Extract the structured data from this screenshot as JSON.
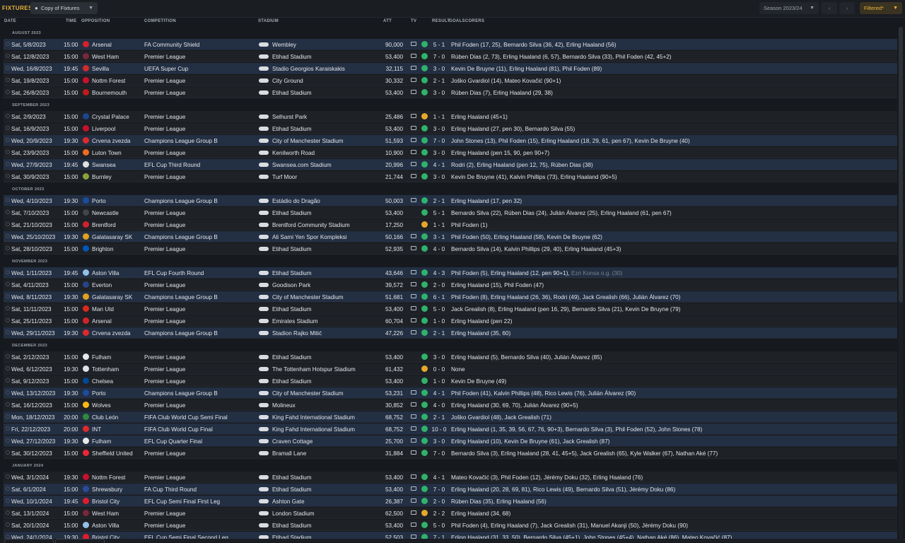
{
  "header": {
    "title": "FIXTURES",
    "view_label": "Copy of Fixtures",
    "season_label": "Season 2023/24",
    "prev_icon": "chevron-left-icon",
    "next_icon": "chevron-right-icon",
    "filter_label": "Filtered*"
  },
  "columns": {
    "date": "DATE",
    "time": "TIME",
    "opposition": "OPPOSITION",
    "competition": "COMPETITION",
    "stadium": "STADIUM",
    "att": "ATT",
    "tv": "TV",
    "result": "RESULT",
    "goalscorers": "GOALSCORERS"
  },
  "colors": {
    "win": "#2fb36b",
    "draw": "#e7a82a",
    "accent": "#e9b53a",
    "alt_row": "#232f43"
  },
  "months": [
    {
      "label": "AUGUST 2023",
      "fixtures": [
        {
          "date": "Sat, 5/8/2023",
          "time": "15:00",
          "opp": "Arsenal",
          "crest": "#d3222b",
          "comp": "FA Community Shield",
          "stadium": "Wembley",
          "att": "90,000",
          "tv": true,
          "outcome": "W",
          "score": "5 - 1",
          "scorers": "Phil Foden (17, 25), Bernardo Silva (36, 42), Erling Haaland (56)",
          "alt": true
        },
        {
          "date": "Sat, 12/8/2023",
          "time": "15:00",
          "opp": "West Ham",
          "crest": "#7a263a",
          "comp": "Premier League",
          "stadium": "Etihad Stadium",
          "att": "53,400",
          "tv": true,
          "outcome": "W",
          "score": "7 - 0",
          "scorers": "Rúben Dias (2, 73), Erling Haaland (6, 57), Bernardo Silva (33), Phil Foden (42, 45+2)"
        },
        {
          "date": "Wed, 16/8/2023",
          "time": "19:45",
          "opp": "Sevilla",
          "crest": "#d42a2a",
          "comp": "UEFA Super Cup",
          "stadium": "Stadio Georgios Karaiskakis",
          "att": "32,115",
          "tv": true,
          "outcome": "W",
          "score": "3 - 0",
          "scorers": "Kevin De Bruyne (11), Erling Haaland (81), Phil Foden (89)",
          "alt": true
        },
        {
          "date": "Sat, 19/8/2023",
          "time": "15:00",
          "opp": "Nottm Forest",
          "crest": "#c8102e",
          "comp": "Premier League",
          "stadium": "City Ground",
          "att": "30,332",
          "tv": true,
          "outcome": "W",
          "score": "2 - 1",
          "scorers": "Joško Gvardiol (14), Mateo Kovačić (90+1)"
        },
        {
          "date": "Sat, 26/8/2023",
          "time": "15:00",
          "opp": "Bournemouth",
          "crest": "#c01a1a",
          "comp": "Premier League",
          "stadium": "Etihad Stadium",
          "att": "53,400",
          "tv": true,
          "outcome": "W",
          "score": "3 - 0",
          "scorers": "Rúben Dias (7), Erling Haaland (29, 38)"
        }
      ]
    },
    {
      "label": "SEPTEMBER 2023",
      "fixtures": [
        {
          "date": "Sat, 2/9/2023",
          "time": "15:00",
          "opp": "Crystal Palace",
          "crest": "#1b458f",
          "comp": "Premier League",
          "stadium": "Selhurst Park",
          "att": "25,486",
          "tv": true,
          "outcome": "D",
          "score": "1 - 1",
          "scorers": "Erling Haaland (45+1)"
        },
        {
          "date": "Sat, 16/9/2023",
          "time": "15:00",
          "opp": "Liverpool",
          "crest": "#c8102e",
          "comp": "Premier League",
          "stadium": "Etihad Stadium",
          "att": "53,400",
          "tv": true,
          "outcome": "W",
          "score": "3 - 0",
          "scorers": "Erling Haaland (27, pen 30), Bernardo Silva (55)"
        },
        {
          "date": "Wed, 20/9/2023",
          "time": "19:30",
          "opp": "Crvena zvezda",
          "crest": "#e02a2a",
          "comp": "Champions League Group B",
          "stadium": "City of Manchester Stadium",
          "att": "51,593",
          "tv": true,
          "outcome": "W",
          "score": "7 - 0",
          "scorers": "John Stones (13), Phil Foden (15), Erling Haaland (18, 29, 61, pen 67), Kevin De Bruyne (40)",
          "alt": true
        },
        {
          "date": "Sat, 23/9/2023",
          "time": "15:00",
          "opp": "Luton Town",
          "crest": "#f26b21",
          "comp": "Premier League",
          "stadium": "Kenilworth Road",
          "att": "10,900",
          "tv": true,
          "outcome": "W",
          "score": "3 - 0",
          "scorers": "Erling Haaland (pen 15, 90, pen 90+7)"
        },
        {
          "date": "Wed, 27/9/2023",
          "time": "19:45",
          "opp": "Swansea",
          "crest": "#e0e0e0",
          "comp": "EFL Cup Third Round",
          "stadium": "Swansea.com Stadium",
          "att": "20,996",
          "tv": true,
          "outcome": "W",
          "score": "4 - 1",
          "scorers": "Rodri (2), Erling Haaland (pen 12, 75), Rúben Dias (38)",
          "alt": true
        },
        {
          "date": "Sat, 30/9/2023",
          "time": "15:00",
          "opp": "Burnley",
          "crest": "#8aa23a",
          "comp": "Premier League",
          "stadium": "Turf Moor",
          "att": "21,744",
          "tv": true,
          "outcome": "W",
          "score": "3 - 0",
          "scorers": "Kevin De Bruyne (41), Kalvin Phillips (73), Erling Haaland (90+5)"
        }
      ]
    },
    {
      "label": "OCTOBER 2023",
      "fixtures": [
        {
          "date": "Wed, 4/10/2023",
          "time": "19:30",
          "opp": "Porto",
          "crest": "#1c4c9c",
          "comp": "Champions League Group B",
          "stadium": "Estádio do Dragão",
          "att": "50,003",
          "tv": true,
          "outcome": "W",
          "score": "2 - 1",
          "scorers": "Erling Haaland (17, pen 32)",
          "alt": true
        },
        {
          "date": "Sat, 7/10/2023",
          "time": "15:00",
          "opp": "Newcastle",
          "crest": "#444444",
          "comp": "Premier League",
          "stadium": "Etihad Stadium",
          "att": "53,400",
          "tv": false,
          "outcome": "W",
          "score": "5 - 1",
          "scorers": "Bernardo Silva (22), Rúben Dias (24), Julián Álvarez (25), Erling Haaland (61, pen 67)"
        },
        {
          "date": "Sat, 21/10/2023",
          "time": "15:00",
          "opp": "Brentford",
          "crest": "#d2202f",
          "comp": "Premier League",
          "stadium": "Brentford Community Stadium",
          "att": "17,250",
          "tv": false,
          "outcome": "D",
          "score": "1 - 1",
          "scorers": "Phil Foden (1)"
        },
        {
          "date": "Wed, 25/10/2023",
          "time": "19:30",
          "opp": "Galatasaray SK",
          "crest": "#e0a020",
          "comp": "Champions League Group B",
          "stadium": "Ali Sami Yen Spor Kompleksi",
          "att": "50,166",
          "tv": true,
          "outcome": "W",
          "score": "3 - 1",
          "scorers": "Phil Foden (50), Erling Haaland (58), Kevin De Bruyne (62)",
          "alt": true
        },
        {
          "date": "Sat, 28/10/2023",
          "time": "15:00",
          "opp": "Brighton",
          "crest": "#0057b8",
          "comp": "Premier League",
          "stadium": "Etihad Stadium",
          "att": "52,935",
          "tv": true,
          "outcome": "W",
          "score": "4 - 0",
          "scorers": "Bernardo Silva (14), Kalvin Phillips (29, 40), Erling Haaland (45+3)"
        }
      ]
    },
    {
      "label": "NOVEMBER 2023",
      "fixtures": [
        {
          "date": "Wed, 1/11/2023",
          "time": "19:45",
          "opp": "Aston Villa",
          "crest": "#95bfe5",
          "comp": "EFL Cup Fourth Round",
          "stadium": "Etihad Stadium",
          "att": "43,646",
          "tv": true,
          "outcome": "W",
          "score": "4 - 3",
          "scorers": "Phil Foden (5), Erling Haaland (12, pen 90+1), ",
          "og": "Ezri Konsa o.g. (30)",
          "alt": true
        },
        {
          "date": "Sat, 4/11/2023",
          "time": "15:00",
          "opp": "Everton",
          "crest": "#274488",
          "comp": "Premier League",
          "stadium": "Goodison Park",
          "att": "39,572",
          "tv": true,
          "outcome": "W",
          "score": "2 - 0",
          "scorers": "Erling Haaland (15), Phil Foden (47)"
        },
        {
          "date": "Wed, 8/11/2023",
          "time": "19:30",
          "opp": "Galatasaray SK",
          "crest": "#e0a020",
          "comp": "Champions League Group B",
          "stadium": "City of Manchester Stadium",
          "att": "51,681",
          "tv": true,
          "outcome": "W",
          "score": "6 - 1",
          "scorers": "Phil Foden (8), Erling Haaland (26, 36), Rodri (49), Jack Grealish (66), Julián Álvarez (70)",
          "alt": true
        },
        {
          "date": "Sat, 11/11/2023",
          "time": "15:00",
          "opp": "Man Utd",
          "crest": "#da291c",
          "comp": "Premier League",
          "stadium": "Etihad Stadium",
          "att": "53,400",
          "tv": true,
          "outcome": "W",
          "score": "5 - 0",
          "scorers": "Jack Grealish (8), Erling Haaland (pen 16, 29), Bernardo Silva (21), Kevin De Bruyne (79)"
        },
        {
          "date": "Sat, 25/11/2023",
          "time": "15:00",
          "opp": "Arsenal",
          "crest": "#d3222b",
          "comp": "Premier League",
          "stadium": "Emirates Stadium",
          "att": "60,704",
          "tv": true,
          "outcome": "W",
          "score": "1 - 0",
          "scorers": "Erling Haaland (pen 22)"
        },
        {
          "date": "Wed, 29/11/2023",
          "time": "19:30",
          "opp": "Crvena zvezda",
          "crest": "#e02a2a",
          "comp": "Champions League Group B",
          "stadium": "Stadion Rajko Mitić",
          "att": "47,226",
          "tv": true,
          "outcome": "W",
          "score": "2 - 1",
          "scorers": "Erling Haaland (35, 60)",
          "alt": true
        }
      ]
    },
    {
      "label": "DECEMBER 2023",
      "fixtures": [
        {
          "date": "Sat, 2/12/2023",
          "time": "15:00",
          "opp": "Fulham",
          "crest": "#e8e8e8",
          "comp": "Premier League",
          "stadium": "Etihad Stadium",
          "att": "53,400",
          "tv": false,
          "outcome": "W",
          "score": "3 - 0",
          "scorers": "Erling Haaland (5), Bernardo Silva (40), Julián Álvarez (85)"
        },
        {
          "date": "Wed, 6/12/2023",
          "time": "19:30",
          "opp": "Tottenham",
          "crest": "#dfe2e8",
          "comp": "Premier League",
          "stadium": "The Tottenham Hotspur Stadium",
          "att": "61,432",
          "tv": false,
          "outcome": "D",
          "score": "0 - 0",
          "scorers": "None"
        },
        {
          "date": "Sat, 9/12/2023",
          "time": "15:00",
          "opp": "Chelsea",
          "crest": "#034694",
          "comp": "Premier League",
          "stadium": "Etihad Stadium",
          "att": "53,400",
          "tv": false,
          "outcome": "W",
          "score": "1 - 0",
          "scorers": "Kevin De Bruyne (49)"
        },
        {
          "date": "Wed, 13/12/2023",
          "time": "19:30",
          "opp": "Porto",
          "crest": "#1c4c9c",
          "comp": "Champions League Group B",
          "stadium": "City of Manchester Stadium",
          "att": "53,231",
          "tv": true,
          "outcome": "W",
          "score": "4 - 1",
          "scorers": "Phil Foden (41), Kalvin Phillips (48), Rico Lewis (76), Julián Álvarez (90)",
          "alt": true
        },
        {
          "date": "Sat, 16/12/2023",
          "time": "15:00",
          "opp": "Wolves",
          "crest": "#fdb913",
          "comp": "Premier League",
          "stadium": "Molineux",
          "att": "30,852",
          "tv": true,
          "outcome": "W",
          "score": "4 - 0",
          "scorers": "Erling Haaland (30, 69, 70), Julián Álvarez (90+5)"
        },
        {
          "date": "Mon, 18/12/2023",
          "time": "20:00",
          "opp": "Club León",
          "crest": "#2e8b3e",
          "comp": "FIFA Club World Cup Semi Final",
          "stadium": "King Fahd International Stadium",
          "att": "68,752",
          "tv": true,
          "outcome": "W",
          "score": "2 - 1",
          "scorers": "Joško Gvardiol (48), Jack Grealish (71)",
          "alt": true
        },
        {
          "date": "Fri, 22/12/2023",
          "time": "20:00",
          "opp": "INT",
          "crest": "#e02a2a",
          "comp": "FIFA Club World Cup Final",
          "stadium": "King Fahd International Stadium",
          "att": "68,752",
          "tv": true,
          "outcome": "W",
          "score": "10 - 0",
          "scorers": "Erling Haaland (1, 35, 39, 56, 67, 76, 90+3), Bernardo Silva (3), Phil Foden (52), John Stones (78)",
          "alt": true
        },
        {
          "date": "Wed, 27/12/2023",
          "time": "19:30",
          "opp": "Fulham",
          "crest": "#e8e8e8",
          "comp": "EFL Cup Quarter Final",
          "stadium": "Craven Cottage",
          "att": "25,700",
          "tv": true,
          "outcome": "W",
          "score": "3 - 0",
          "scorers": "Erling Haaland (10), Kevin De Bruyne (61), Jack Grealish (87)",
          "alt": true
        },
        {
          "date": "Sat, 30/12/2023",
          "time": "15:00",
          "opp": "Sheffield United",
          "crest": "#ee2737",
          "comp": "Premier League",
          "stadium": "Bramall Lane",
          "att": "31,884",
          "tv": true,
          "outcome": "W",
          "score": "7 - 0",
          "scorers": "Bernardo Silva (3), Erling Haaland (28, 41, 45+5), Jack Grealish (65), Kyle Walker (67), Nathan Aké (77)"
        }
      ]
    },
    {
      "label": "JANUARY 2024",
      "fixtures": [
        {
          "date": "Wed, 3/1/2024",
          "time": "19:30",
          "opp": "Nottm Forest",
          "crest": "#c8102e",
          "comp": "Premier League",
          "stadium": "Etihad Stadium",
          "att": "53,400",
          "tv": true,
          "outcome": "W",
          "score": "4 - 1",
          "scorers": "Mateo Kovačić (3), Phil Foden (12), Jérémy Doku (32), Erling Haaland (76)"
        },
        {
          "date": "Sat, 6/1/2024",
          "time": "15:00",
          "opp": "Shrewsbury",
          "crest": "#2a4b9b",
          "comp": "FA Cup Third Round",
          "stadium": "Etihad Stadium",
          "att": "53,400",
          "tv": true,
          "outcome": "W",
          "score": "7 - 0",
          "scorers": "Erling Haaland (20, 28, 69, 81), Rico Lewis (49), Bernardo Silva (51), Jérémy Doku (86)",
          "alt": true
        },
        {
          "date": "Wed, 10/1/2024",
          "time": "19:45",
          "opp": "Bristol City",
          "crest": "#e21b2b",
          "comp": "EFL Cup Semi Final First Leg",
          "stadium": "Ashton Gate",
          "att": "26,387",
          "tv": true,
          "outcome": "W",
          "score": "2 - 0",
          "scorers": "Rúben Dias (35), Erling Haaland (56)",
          "alt": true
        },
        {
          "date": "Sat, 13/1/2024",
          "time": "15:00",
          "opp": "West Ham",
          "crest": "#7a263a",
          "comp": "Premier League",
          "stadium": "London Stadium",
          "att": "62,500",
          "tv": true,
          "outcome": "D",
          "score": "2 - 2",
          "scorers": "Erling Haaland (34, 68)"
        },
        {
          "date": "Sat, 20/1/2024",
          "time": "15:00",
          "opp": "Aston Villa",
          "crest": "#95bfe5",
          "comp": "Premier League",
          "stadium": "Etihad Stadium",
          "att": "53,400",
          "tv": true,
          "outcome": "W",
          "score": "5 - 0",
          "scorers": "Phil Foden (4), Erling Haaland (7), Jack Grealish (31), Manuel Akanji (50), Jérémy Doku (90)"
        },
        {
          "date": "Wed, 24/1/2024",
          "time": "19:30",
          "opp": "Bristol City",
          "crest": "#e21b2b",
          "comp": "EFL Cup Semi Final Second Leg",
          "stadium": "Etihad Stadium",
          "att": "52,503",
          "tv": true,
          "outcome": "W",
          "score": "7 - 1",
          "scorers": "Erling Haaland (31, 33, 50), Bernardo Silva (45+1), John Stones (45+4), Nathan Aké (86), Mateo Kovačić (87)",
          "alt": true
        }
      ]
    }
  ]
}
